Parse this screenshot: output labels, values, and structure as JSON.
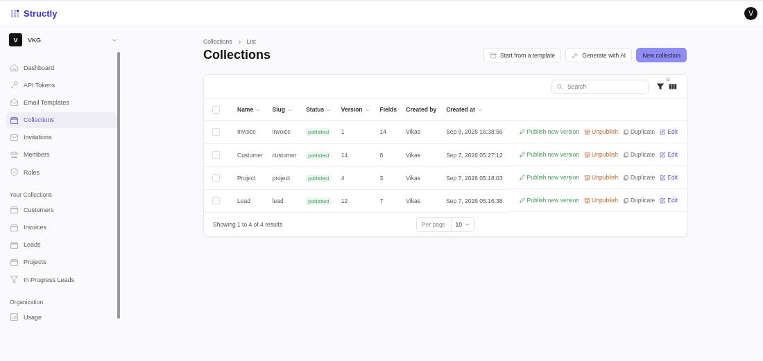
{
  "app": {
    "name": "Structly",
    "user_initial": "V"
  },
  "workspace": {
    "initial": "V",
    "name": "VKG"
  },
  "sidebar": {
    "sections": [
      {
        "items": [
          {
            "label": "Dashboard",
            "kind": "home",
            "selected": false
          },
          {
            "label": "API Tokens",
            "kind": "key",
            "selected": false
          },
          {
            "label": "Email Templates",
            "kind": "mail-open",
            "selected": false
          },
          {
            "label": "Collections",
            "kind": "box",
            "selected": true
          },
          {
            "label": "Invitations",
            "kind": "mail",
            "selected": false
          },
          {
            "label": "Members",
            "kind": "users",
            "selected": false
          },
          {
            "label": "Roles",
            "kind": "shield",
            "selected": false
          }
        ]
      },
      {
        "title": "Your Collections",
        "items": [
          {
            "label": "Customers",
            "kind": "box",
            "selected": false
          },
          {
            "label": "Invoices",
            "kind": "box",
            "selected": false
          },
          {
            "label": "Leads",
            "kind": "box",
            "selected": false
          },
          {
            "label": "Projects",
            "kind": "box",
            "selected": false
          },
          {
            "label": "In Progress Leads",
            "kind": "filter",
            "selected": false
          }
        ]
      },
      {
        "title": "Organization",
        "items": [
          {
            "label": "Usage",
            "kind": "chart",
            "selected": false
          }
        ]
      }
    ]
  },
  "breadcrumb": [
    "Collections",
    "List"
  ],
  "page_title": "Collections",
  "actions": [
    {
      "label": "Start from a template",
      "kind": "template"
    },
    {
      "label": "Generate with AI",
      "kind": "ai"
    },
    {
      "label": "New collection",
      "kind": "primary"
    }
  ],
  "search": {
    "placeholder": "Search"
  },
  "filter_count": "0",
  "table": {
    "columns": [
      {
        "label": "Name",
        "sortable": true
      },
      {
        "label": "Slug",
        "sortable": true
      },
      {
        "label": "Status",
        "sortable": true
      },
      {
        "label": "Version",
        "sortable": true
      },
      {
        "label": "Fields",
        "sortable": false
      },
      {
        "label": "Created by",
        "sortable": false
      },
      {
        "label": "Created at",
        "sortable": true
      }
    ],
    "header_checked": false,
    "rows": [
      {
        "checked": false,
        "cells": [
          "Invoice",
          "invoice",
          "published",
          "1",
          "14",
          "Vikas",
          "Sep 9, 2026 16:38:56"
        ],
        "actions": [
          {
            "label": "Publish new version",
            "kind": "publish"
          },
          {
            "label": "Unpublish",
            "kind": "unpublish"
          },
          {
            "label": "Duplicate",
            "kind": "duplicate"
          },
          {
            "label": "Edit",
            "kind": "edit"
          }
        ]
      },
      {
        "checked": false,
        "cells": [
          "Customer",
          "customer",
          "published",
          "14",
          "8",
          "Vikas",
          "Sep 7, 2026 05:27:12"
        ],
        "actions": [
          {
            "label": "Publish new version",
            "kind": "publish"
          },
          {
            "label": "Unpublish",
            "kind": "unpublish"
          },
          {
            "label": "Duplicate",
            "kind": "duplicate"
          },
          {
            "label": "Edit",
            "kind": "edit"
          }
        ]
      },
      {
        "checked": false,
        "cells": [
          "Project",
          "project",
          "published",
          "4",
          "3",
          "Vikas",
          "Sep 7, 2026 05:18:03"
        ],
        "actions": [
          {
            "label": "Publish new version",
            "kind": "publish"
          },
          {
            "label": "Unpublish",
            "kind": "unpublish"
          },
          {
            "label": "Duplicate",
            "kind": "duplicate"
          },
          {
            "label": "Edit",
            "kind": "edit"
          }
        ]
      },
      {
        "checked": false,
        "cells": [
          "Lead",
          "lead",
          "published",
          "12",
          "7",
          "Vikas",
          "Sep 7, 2026 05:16:38"
        ],
        "actions": [
          {
            "label": "Publish new version",
            "kind": "publish"
          },
          {
            "label": "Unpublish",
            "kind": "unpublish"
          },
          {
            "label": "Duplicate",
            "kind": "duplicate"
          },
          {
            "label": "Edit",
            "kind": "edit"
          }
        ]
      }
    ]
  },
  "footer": {
    "summary": "Showing 1 to 4 of 4 results",
    "per_page_label": "Per page",
    "per_page": "10"
  }
}
